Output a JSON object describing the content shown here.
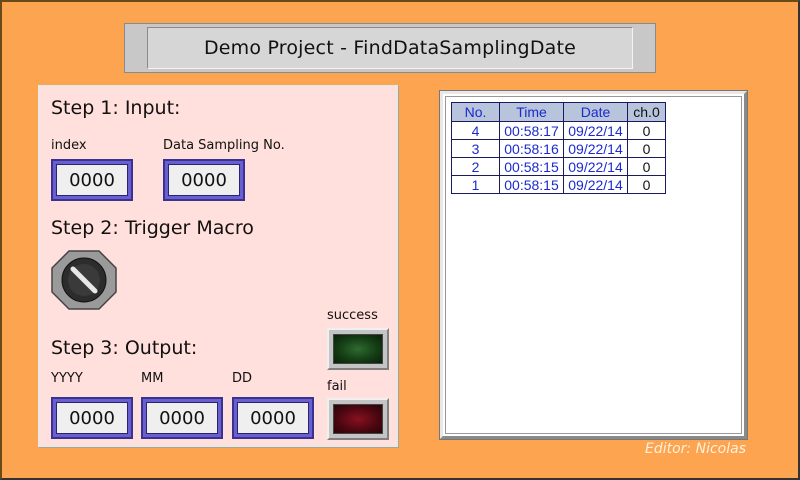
{
  "title": "Demo Project - FindDataSamplingDate",
  "step1": {
    "heading": "Step 1: Input:",
    "index_label": "index",
    "index_value": "0000",
    "sampling_label": "Data Sampling No.",
    "sampling_value": "0000"
  },
  "step2": {
    "heading": "Step 2: Trigger Macro"
  },
  "step3": {
    "heading": "Step 3: Output:",
    "yyyy_label": "YYYY",
    "yyyy_value": "0000",
    "mm_label": "MM",
    "mm_value": "0000",
    "dd_label": "DD",
    "dd_value": "0000"
  },
  "indicators": {
    "success_label": "success",
    "fail_label": "fail"
  },
  "table": {
    "headers": [
      "No.",
      "Time",
      "Date",
      "ch.0"
    ],
    "rows": [
      [
        "4",
        "00:58:17",
        "09/22/14",
        "0"
      ],
      [
        "3",
        "00:58:16",
        "09/22/14",
        "0"
      ],
      [
        "2",
        "00:58:15",
        "09/22/14",
        "0"
      ],
      [
        "1",
        "00:58:15",
        "09/22/14",
        "0"
      ]
    ]
  },
  "editor": "Editor: Nicolas",
  "colors": {
    "background": "#fca44f",
    "panel": "#ffe0dc",
    "input_border": "#6a5fd0",
    "table_text": "#1a2ad0"
  }
}
